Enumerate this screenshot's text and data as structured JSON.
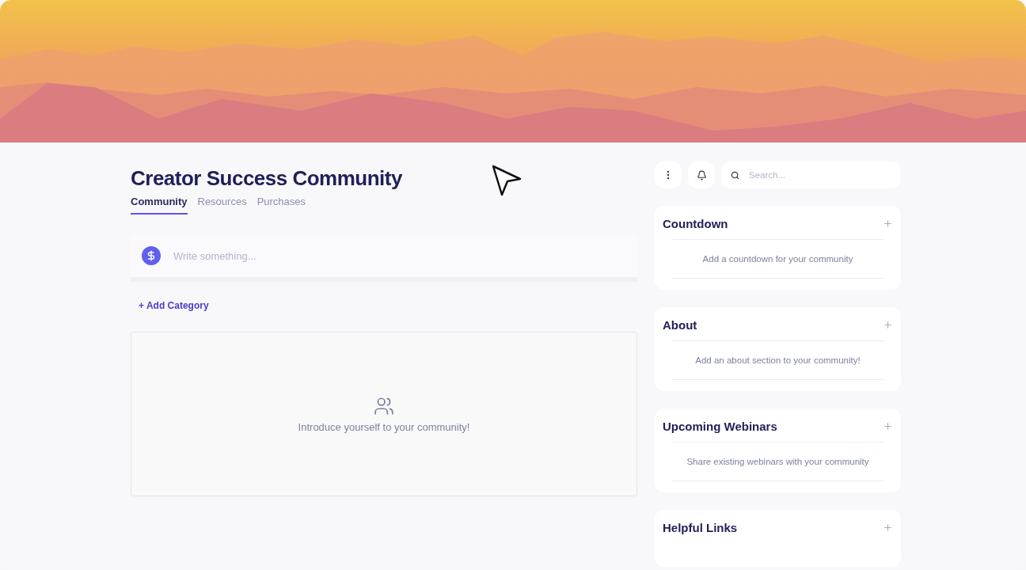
{
  "header": {
    "title": "Creator Success Community"
  },
  "tabs": [
    {
      "label": "Community",
      "selected": true
    },
    {
      "label": "Resources",
      "selected": false
    },
    {
      "label": "Purchases",
      "selected": false
    }
  ],
  "composer": {
    "placeholder": "Write something..."
  },
  "add_category": {
    "label": "+ Add Category"
  },
  "empty_feed": {
    "message": "Introduce yourself to your community!"
  },
  "search": {
    "placeholder": "Search..."
  },
  "widgets": [
    {
      "title": "Countdown",
      "description": "Add a countdown for your community"
    },
    {
      "title": "About",
      "description": "Add an about section to your community!"
    },
    {
      "title": "Upcoming Webinars",
      "description": "Share existing webinars with your community"
    },
    {
      "title": "Helpful Links"
    }
  ]
}
